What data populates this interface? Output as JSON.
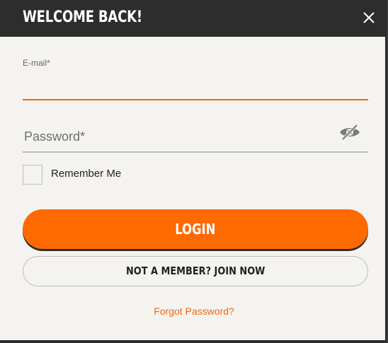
{
  "header": {
    "title": "WELCOME BACK!",
    "close_icon": "close-icon"
  },
  "form": {
    "email": {
      "label": "E-mail*",
      "value": "",
      "placeholder": ""
    },
    "password": {
      "placeholder": "Password*",
      "value": "",
      "toggle_icon": "eye-slash-icon"
    },
    "remember": {
      "label": "Remember Me",
      "checked": false
    },
    "login_label": "LOGIN",
    "join_label": "NOT A MEMBER? JOIN NOW",
    "forgot_label": "Forgot Password?"
  },
  "colors": {
    "accent": "#ff6a00",
    "header_bg": "#2d2d2d",
    "modal_bg": "#f4f3ef",
    "link": "#f06a11"
  }
}
